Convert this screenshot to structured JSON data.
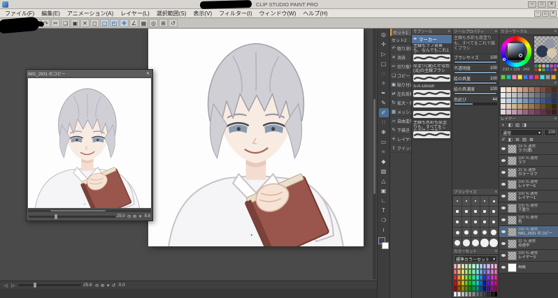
{
  "titlebar": {
    "title": "CLIP STUDIO PAINT PRO",
    "window_buttons": [
      {
        "glyph": "─",
        "name": "minimize-button"
      },
      {
        "glyph": "□",
        "name": "maximize-button"
      },
      {
        "glyph": "✕",
        "name": "close-button"
      }
    ]
  },
  "menubar": {
    "items": [
      {
        "label": "ファイル(F)",
        "name": "menu-file"
      },
      {
        "label": "編集(E)",
        "name": "menu-edit"
      },
      {
        "label": "アニメーション(A)",
        "name": "menu-animation"
      },
      {
        "label": "レイヤー(L)",
        "name": "menu-layer"
      },
      {
        "label": "選択範囲(S)",
        "name": "menu-select"
      },
      {
        "label": "表示(V)",
        "name": "menu-view"
      },
      {
        "label": "フィルター(I)",
        "name": "menu-filter"
      },
      {
        "label": "ウィンドウ(W)",
        "name": "menu-window"
      },
      {
        "label": "ヘルプ(H)",
        "name": "menu-help"
      }
    ],
    "doc_buttons": [
      {
        "glyph": "─",
        "name": "doc-minimize-button"
      },
      {
        "glyph": "◱",
        "name": "doc-restore-button"
      },
      {
        "glyph": "✕",
        "name": "doc-close-button"
      }
    ]
  },
  "toolbar": {
    "icons": [
      {
        "glyph": "▤",
        "name": "new-file-icon",
        "bg": ""
      },
      {
        "glyph": "▨",
        "name": "open-file-icon",
        "bg": ""
      },
      {
        "glyph": "◫",
        "name": "save-icon",
        "bg": ""
      },
      {
        "glyph": "↶",
        "name": "undo-icon",
        "bg": ""
      },
      {
        "glyph": "↷",
        "name": "redo-icon",
        "bg": ""
      },
      {
        "glyph": "✂",
        "name": "cut-icon",
        "bg": ""
      },
      {
        "glyph": "❏",
        "name": "copy-icon",
        "bg": ""
      },
      {
        "glyph": "▣",
        "name": "paste-icon",
        "bg": ""
      },
      {
        "glyph": "✕",
        "name": "delete-icon",
        "bg": ""
      },
      {
        "glyph": "◻",
        "name": "deselect-icon",
        "bg": ""
      },
      {
        "glyph": "▢",
        "name": "select-area-icon",
        "bg": "#b9d2ea"
      },
      {
        "glyph": "◰",
        "name": "selection-launcher-icon",
        "bg": "#b9d2ea"
      },
      {
        "glyph": "✛",
        "name": "snap-ruler-icon",
        "bg": "#b9d2ea"
      },
      {
        "glyph": "∠",
        "name": "snap-special-ruler-icon",
        "bg": ""
      },
      {
        "glyph": "▦",
        "name": "grid-icon",
        "bg": ""
      },
      {
        "glyph": "◎",
        "name": "zoom-icon",
        "bg": ""
      },
      {
        "glyph": "⊞",
        "name": "fit-to-screen-icon",
        "bg": ""
      },
      {
        "glyph": "↺",
        "name": "rotate-reset-icon",
        "bg": ""
      }
    ]
  },
  "tools": {
    "items": [
      {
        "glyph": "◎",
        "name": "zoom-tool-icon",
        "bg": ""
      },
      {
        "glyph": "✛",
        "name": "move-tool-icon",
        "bg": ""
      },
      {
        "glyph": "▷",
        "name": "operation-tool-icon",
        "bg": ""
      },
      {
        "glyph": "▢",
        "name": "selection-tool-icon",
        "bg": ""
      },
      {
        "glyph": "◌",
        "name": "auto-select-tool-icon",
        "bg": ""
      },
      {
        "glyph": "✧",
        "name": "eyedropper-tool-icon",
        "bg": ""
      },
      {
        "glyph": "✒",
        "name": "pen-tool-icon",
        "bg": ""
      },
      {
        "glyph": "✎",
        "name": "pencil-tool-icon",
        "bg": ""
      },
      {
        "glyph": "✐",
        "name": "brush-tool-icon",
        "bg": "#4a6e96"
      },
      {
        "glyph": "∷",
        "name": "airbrush-tool-icon",
        "bg": ""
      },
      {
        "glyph": "❋",
        "name": "decoration-tool-icon",
        "bg": ""
      },
      {
        "glyph": "▭",
        "name": "eraser-tool-icon",
        "bg": ""
      },
      {
        "glyph": "≈",
        "name": "blend-tool-icon",
        "bg": ""
      },
      {
        "glyph": "◆",
        "name": "fill-tool-icon",
        "bg": ""
      },
      {
        "glyph": "▧",
        "name": "gradient-tool-icon",
        "bg": ""
      },
      {
        "glyph": "△",
        "name": "figure-tool-icon",
        "bg": ""
      },
      {
        "glyph": "▣",
        "name": "frame-border-tool-icon",
        "bg": ""
      },
      {
        "glyph": "∟",
        "name": "ruler-tool-icon",
        "bg": ""
      },
      {
        "glyph": "T",
        "name": "text-tool-icon",
        "bg": ""
      },
      {
        "glyph": "❍",
        "name": "balloon-tool-icon",
        "bg": ""
      },
      {
        "glyph": "≀",
        "name": "line-correct-tool-icon",
        "bg": ""
      }
    ],
    "fg_color": "#35425c",
    "bg_color": "#ffffff"
  },
  "quick_access": {
    "tabs": [
      {
        "label": "セット1"
      },
      {
        "label": "セット2"
      }
    ],
    "items": [
      {
        "label": "取り消し",
        "glyph": "↶",
        "name": "qa-undo-item"
      },
      {
        "label": "消去",
        "glyph": "✕",
        "name": "qa-clear-item"
      },
      {
        "label": "切り取り",
        "glyph": "✂",
        "name": "qa-cut-item"
      },
      {
        "label": "コピー",
        "glyph": "❏",
        "name": "qa-copy-item"
      },
      {
        "label": "貼り付け",
        "glyph": "▣",
        "name": "qa-paste-item"
      },
      {
        "label": "左右反転",
        "glyph": "⇄",
        "name": "qa-flip-horizontal-item"
      },
      {
        "label": "拡大・縮小・回転",
        "glyph": "↻",
        "name": "qa-scale-rotate-item"
      },
      {
        "label": "メッシュ変形",
        "glyph": "▦",
        "name": "qa-mesh-transform-item"
      },
      {
        "label": "自由変形",
        "glyph": "▱",
        "name": "qa-free-transform-item"
      },
      {
        "label": "下描き",
        "glyph": "✎",
        "name": "qa-draft-item"
      },
      {
        "label": "レイヤー移動",
        "glyph": "✛",
        "name": "qa-move-layer-item"
      },
      {
        "label": "クイック共有",
        "glyph": "⇪",
        "name": "qa-quick-share-item"
      }
    ]
  },
  "sub_tool": {
    "header": "サブツール",
    "selected_label": "マーカー",
    "pen_glyph": "✒",
    "items": [
      {
        "name": "主線もラフ背景も、なんでもこれ1本"
      },
      {
        "name": "厚塗り(濃)とか混色(淡)の主線ブラシ"
      },
      {
        "name": "S-A-1brush"
      },
      {
        "name": ""
      },
      {
        "name": ""
      },
      {
        "name": "主線も水彩も厚塗りも、すべてをこれで描くブラシ"
      }
    ]
  },
  "tool_property": {
    "title": "ツールプロパティ",
    "menu_glyph": "≡",
    "description": "主線も水彩も厚塗りも、すべてをこれで描くブラシ",
    "sliders": [
      {
        "label": "ブラシサイズ",
        "value": "100",
        "pct": 100
      },
      {
        "label": "不透明度",
        "value": "100",
        "pct": 100
      },
      {
        "label": "絵の具量",
        "value": "100",
        "pct": 100
      },
      {
        "label": "絵の具濃度",
        "value": "100",
        "pct": 100
      },
      {
        "label": "色延び",
        "value": "44",
        "pct": 44
      }
    ]
  },
  "brush_sizes": {
    "title": "ブラシサイズ",
    "sizes": [
      1,
      2,
      3,
      4,
      5,
      6,
      7,
      8,
      9,
      10,
      12,
      14,
      16,
      18,
      20,
      25,
      30,
      35,
      40,
      50,
      60,
      70,
      80,
      90,
      100
    ]
  },
  "color_set": {
    "tab": "カラーセット",
    "selected": "標準カラーセット",
    "arrow": "▾",
    "colors": [
      "hsl(0,75%,85%)",
      "hsl(30,75%,85%)",
      "hsl(60,75%,85%)",
      "hsl(90,75%,85%)",
      "hsl(120,75%,85%)",
      "hsl(150,75%,85%)",
      "hsl(180,75%,85%)",
      "hsl(210,75%,85%)",
      "hsl(240,75%,85%)",
      "hsl(270,75%,85%)",
      "hsl(300,75%,85%)",
      "hsl(330,75%,85%)",
      "hsl(0,75%,70%)",
      "hsl(30,75%,70%)",
      "hsl(60,75%,70%)",
      "hsl(90,75%,70%)",
      "hsl(120,75%,70%)",
      "hsl(150,75%,70%)",
      "hsl(180,75%,70%)",
      "hsl(210,75%,70%)",
      "hsl(240,75%,70%)",
      "hsl(270,75%,70%)",
      "hsl(300,75%,70%)",
      "hsl(330,75%,70%)",
      "hsl(0,80%,55%)",
      "hsl(30,80%,55%)",
      "hsl(60,80%,55%)",
      "hsl(90,80%,55%)",
      "hsl(120,80%,55%)",
      "hsl(150,80%,55%)",
      "hsl(180,80%,55%)",
      "hsl(210,80%,55%)",
      "hsl(240,80%,55%)",
      "hsl(270,80%,55%)",
      "hsl(300,80%,55%)",
      "hsl(330,80%,55%)",
      "hsl(0,85%,45%)",
      "hsl(30,85%,45%)",
      "hsl(60,85%,45%)",
      "hsl(90,85%,45%)",
      "hsl(120,85%,45%)",
      "hsl(150,85%,45%)",
      "hsl(180,85%,45%)",
      "hsl(210,85%,45%)",
      "hsl(240,85%,45%)",
      "hsl(270,85%,45%)",
      "hsl(300,85%,45%)",
      "hsl(330,85%,45%)",
      "hsl(0,85%,32%)",
      "hsl(30,85%,32%)",
      "hsl(60,85%,32%)",
      "hsl(90,85%,32%)",
      "hsl(120,85%,32%)",
      "hsl(150,85%,32%)",
      "hsl(180,85%,32%)",
      "hsl(210,85%,32%)",
      "hsl(240,85%,32%)",
      "hsl(270,85%,32%)",
      "hsl(300,85%,32%)",
      "hsl(330,85%,32%)",
      "hsl(0,0%,100%)",
      "hsl(0,0%,91%)",
      "hsl(0,0%,82%)",
      "hsl(0,0%,73%)",
      "hsl(0,0%,64%)",
      "hsl(0,0%,55%)",
      "hsl(0,0%,45%)",
      "hsl(0,0%,36%)",
      "hsl(0,0%,27%)",
      "hsl(0,0%,18%)",
      "hsl(0,0%,9%)",
      "hsl(0,0%,0%)"
    ]
  },
  "color_wheel": {
    "title": "カラーサークル",
    "values_text": "233 × 239 : 243"
  },
  "color_mix": {
    "circles": [
      "#2b3750",
      "#8e96a4",
      "#d9c6aa"
    ],
    "dots": [
      "#3a7a6a",
      "#a8b840",
      "#e89ab0",
      "#40c8d8",
      "#d84898",
      "#8858c8",
      "#c8c8c8",
      "#a83828",
      "#e8c838",
      "#48a848",
      "#3858c8",
      "#7838a8",
      "#d87828",
      "#404040"
    ]
  },
  "mini_swatches": [
    "#6cc24a",
    "#2fb8a6",
    "#ef8fb4",
    "#f2e34a",
    "#3f7fe0",
    "#a64ae0",
    "#e04a4a",
    "#4ae0e0",
    "#9a9a9a",
    "#e0a64a"
  ],
  "color_history": {
    "colors": [
      "#f6e9e0",
      "#f0d9c8",
      "#e8c5ae",
      "#d9a98d",
      "#c98f72",
      "#b27757",
      "#96604a",
      "#7a4c3a",
      "#5e3a2c",
      "#462b20",
      "#e8e8ea",
      "#d5d5d8",
      "#c2c2c6",
      "#aeaeb4",
      "#9a9aa2",
      "#868690",
      "#72727e",
      "#5e5e6c",
      "#4a4a5a",
      "#363648",
      "#dce4ee",
      "#c3d0e2",
      "#aabcd6",
      "#91a8ca",
      "#7894be",
      "#5f80b2",
      "#4d6ca0",
      "#3f588a",
      "#324674",
      "#25345e",
      "#ece2d4",
      "#ddcdb4",
      "#ceb894",
      "#bfa374",
      "#b08e54",
      "#9c7a44",
      "#826536",
      "#685028",
      "#4e3b1a",
      "#34260c",
      "#e2d4dc",
      "#d0b8c6",
      "#be9cb0",
      "#ac809a",
      "#9a6484",
      "#88486e",
      "#743a5c",
      "#60304a",
      "#4c2638",
      "#381c26"
    ]
  },
  "layers": {
    "tab": "レイヤー",
    "header_icons": [
      {
        "glyph": "◐",
        "name": "layer-effect-icon"
      },
      {
        "glyph": "◧",
        "name": "layer-mask-icon"
      },
      {
        "glyph": "▥",
        "name": "layer-tone-icon"
      },
      {
        "glyph": "◨",
        "name": "layer-ruler-icon"
      }
    ],
    "blend_mode": "通常",
    "blend_arrow": "▾",
    "opacity": "100",
    "lock_icons": [
      {
        "glyph": "✐",
        "name": "lock-transparent-pixels-icon"
      },
      {
        "glyph": "◧",
        "name": "clip-to-layer-below-icon"
      },
      {
        "glyph": "⊞",
        "name": "lock-layer-icon"
      },
      {
        "glyph": "▤",
        "name": "set-as-reference-icon"
      },
      {
        "glyph": "⊠",
        "name": "draft-layer-icon"
      }
    ],
    "list": [
      {
        "meta": "24 % 通常",
        "name": "ラフ(漫)",
        "thumb": "",
        "row_bg": ""
      },
      {
        "meta": "100 % 通常",
        "name": "ラフ",
        "thumb": "",
        "row_bg": ""
      },
      {
        "meta": "21 % 通常",
        "name": "カラーラフ",
        "thumb": "",
        "row_bg": ""
      },
      {
        "meta": "100 % 通常",
        "name": "レイヤー6",
        "thumb": "",
        "row_bg": ""
      },
      {
        "meta": "100 % 通常",
        "name": "レイヤー1",
        "thumb": "",
        "row_bg": ""
      },
      {
        "meta": "100 % 通常",
        "name": "下塗り",
        "thumb": "",
        "row_bg": ""
      },
      {
        "meta": "100 % 通常",
        "name": "色",
        "thumb": "",
        "row_bg": ""
      },
      {
        "meta": "100 % 通常",
        "name": "IMG_2931 のコピー",
        "thumb": "",
        "row_bg": "#506882"
      },
      {
        "meta": "31 % 通常",
        "name": "点途中",
        "thumb": "",
        "row_bg": ""
      },
      {
        "meta": "100 % 通常",
        "name": "レイヤー3",
        "thumb": "",
        "row_bg": ""
      },
      {
        "meta": "",
        "name": "用紙",
        "thumb": "#ffffff",
        "row_bg": ""
      }
    ]
  },
  "document": {
    "main": {
      "zoom": "25.6",
      "angle": "0.0",
      "icons": [
        {
          "glyph": "⊖",
          "name": "zoom-out-icon"
        },
        {
          "glyph": "⊕",
          "name": "zoom-in-icon"
        },
        {
          "glyph": "▾",
          "name": "zoom-presets-icon"
        },
        {
          "glyph": "↺",
          "name": "rotate-reset-icon"
        }
      ]
    },
    "floating": {
      "title": "IMG_2931 のコピー",
      "close_glyph": "✕",
      "zoom": "25.0",
      "angle": "8.8",
      "icons": [
        {
          "glyph": "⊖",
          "name": "zoom-out-icon"
        },
        {
          "glyph": "⊕",
          "name": "zoom-in-icon"
        },
        {
          "glyph": "▾",
          "name": "zoom-presets-icon"
        }
      ]
    }
  }
}
